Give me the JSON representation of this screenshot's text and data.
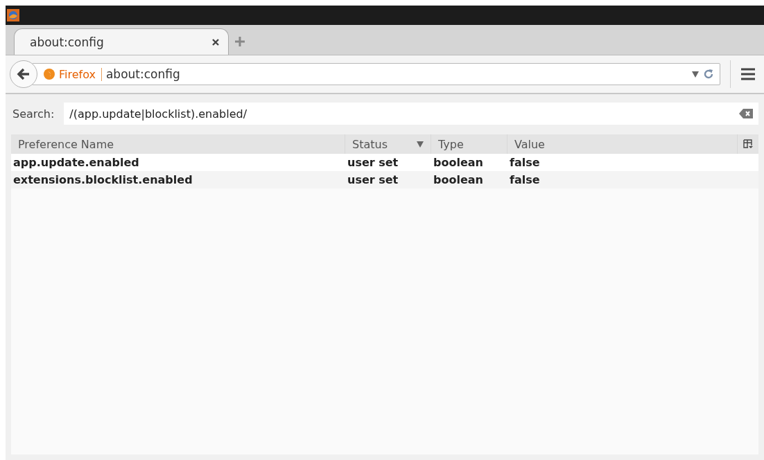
{
  "tabs": [
    {
      "label": "about:config",
      "selected": true
    }
  ],
  "address_bar": {
    "identity": "Firefox",
    "url": "about:config"
  },
  "search": {
    "label": "Search:",
    "value": "/(app.update|blocklist).enabled/"
  },
  "table": {
    "columns": [
      {
        "label": "Preference Name",
        "sorted": false
      },
      {
        "label": "Status",
        "sorted": true
      },
      {
        "label": "Type",
        "sorted": false
      },
      {
        "label": "Value",
        "sorted": false
      }
    ],
    "rows": [
      {
        "name": "app.update.enabled",
        "status": "user set",
        "type": "boolean",
        "value": "false",
        "modified": true
      },
      {
        "name": "extensions.blocklist.enabled",
        "status": "user set",
        "type": "boolean",
        "value": "false",
        "modified": true
      }
    ]
  }
}
